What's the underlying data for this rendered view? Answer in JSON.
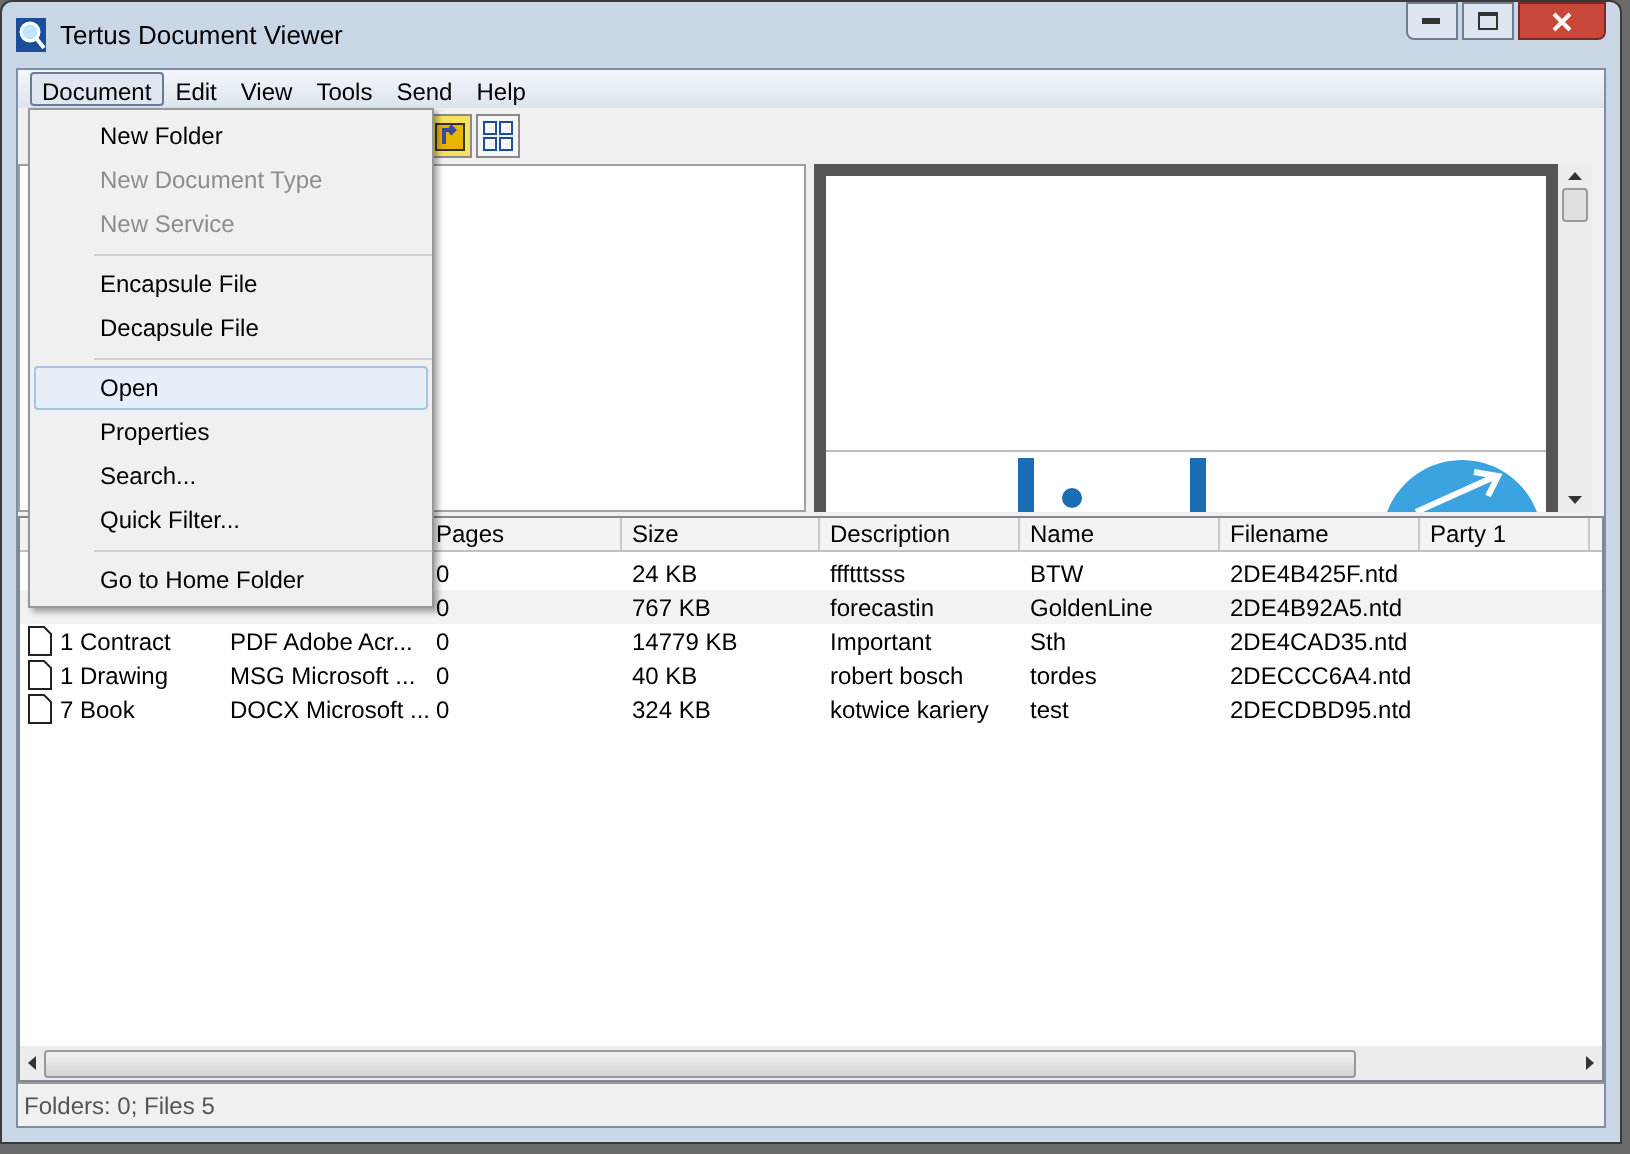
{
  "window": {
    "title": "Tertus Document Viewer"
  },
  "menubar": [
    {
      "label": "Document",
      "selected": true
    },
    {
      "label": "Edit",
      "selected": false
    },
    {
      "label": "View",
      "selected": false
    },
    {
      "label": "Tools",
      "selected": false
    },
    {
      "label": "Send",
      "selected": false
    },
    {
      "label": "Help",
      "selected": false
    }
  ],
  "menu": [
    {
      "kind": "item",
      "label": "New Folder",
      "disabled": false,
      "selected": false
    },
    {
      "kind": "item",
      "label": "New Document Type",
      "disabled": true,
      "selected": false
    },
    {
      "kind": "item",
      "label": "New Service",
      "disabled": true,
      "selected": false
    },
    {
      "kind": "separator"
    },
    {
      "kind": "item",
      "label": "Encapsule File",
      "disabled": false,
      "selected": false
    },
    {
      "kind": "item",
      "label": "Decapsule File",
      "disabled": false,
      "selected": false
    },
    {
      "kind": "separator"
    },
    {
      "kind": "item",
      "label": "Open",
      "disabled": false,
      "selected": true
    },
    {
      "kind": "item",
      "label": "Properties",
      "disabled": false,
      "selected": false
    },
    {
      "kind": "item",
      "label": "Search...",
      "disabled": false,
      "selected": false
    },
    {
      "kind": "item",
      "label": "Quick Filter...",
      "disabled": false,
      "selected": false
    },
    {
      "kind": "separator"
    },
    {
      "kind": "item",
      "label": "Go to Home Folder",
      "disabled": false,
      "selected": false
    }
  ],
  "table": {
    "columns": [
      "Pages",
      "Size",
      "Description",
      "Name",
      "Filename",
      "Party 1"
    ],
    "rows": [
      {
        "cells": [
          "0",
          "24 KB",
          "ffftttsss",
          "BTW",
          "2DE4B425F.ntd"
        ],
        "selected": false
      },
      {
        "cells": [
          "0",
          "767 KB",
          "forecastin",
          "GoldenLine",
          "2DE4B92A5.ntd"
        ],
        "selected": true
      },
      {
        "type_name": "1 Contract",
        "format": "PDF Adobe Acr...",
        "cells": [
          "0",
          "14779 KB",
          "Important",
          "Sth",
          "2DE4CAD35.ntd"
        ],
        "selected": false
      },
      {
        "type_name": "1 Drawing",
        "format": "MSG Microsoft ...",
        "cells": [
          "0",
          "40 KB",
          "robert bosch",
          "tordes",
          "2DECCC6A4.ntd"
        ],
        "selected": false
      },
      {
        "type_name": "7 Book",
        "format": "DOCX Microsoft ...",
        "cells": [
          "0",
          "324 KB",
          "kotwice kariery",
          "test",
          "2DECDBD95.ntd"
        ],
        "selected": false
      }
    ]
  },
  "status_bar": "Folders: 0; Files 5"
}
